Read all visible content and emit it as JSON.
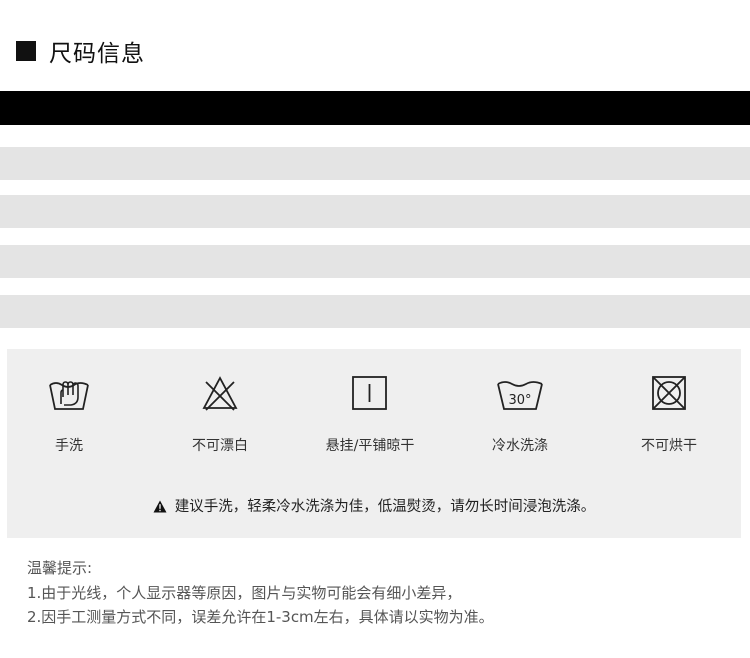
{
  "section": {
    "title": "尺码信息"
  },
  "care": {
    "items": [
      {
        "icon": "hand-wash-icon",
        "label": "手洗"
      },
      {
        "icon": "no-bleach-icon",
        "label": "不可漂白"
      },
      {
        "icon": "hang-dry-icon",
        "label": "悬挂/平铺晾干"
      },
      {
        "icon": "cold-wash-30-icon",
        "label": "冷水洗涤",
        "temp": "30°"
      },
      {
        "icon": "no-tumble-dry-icon",
        "label": "不可烘干"
      }
    ],
    "tip": "建议手洗，轻柔冷水洗涤为佳，低温熨烫，请勿长时间浸泡洗涤。"
  },
  "notes": {
    "heading": "温馨提示:",
    "line1": "1.由于光线，个人显示器等原因，图片与实物可能会有细小差异，",
    "line2": "2.因手工测量方式不同，误差允许在1-3cm左右，具体请以实物为准。"
  },
  "colors": {
    "table_header": "#000000",
    "table_row": "#e4e4e4",
    "panel_bg": "#efefef"
  }
}
